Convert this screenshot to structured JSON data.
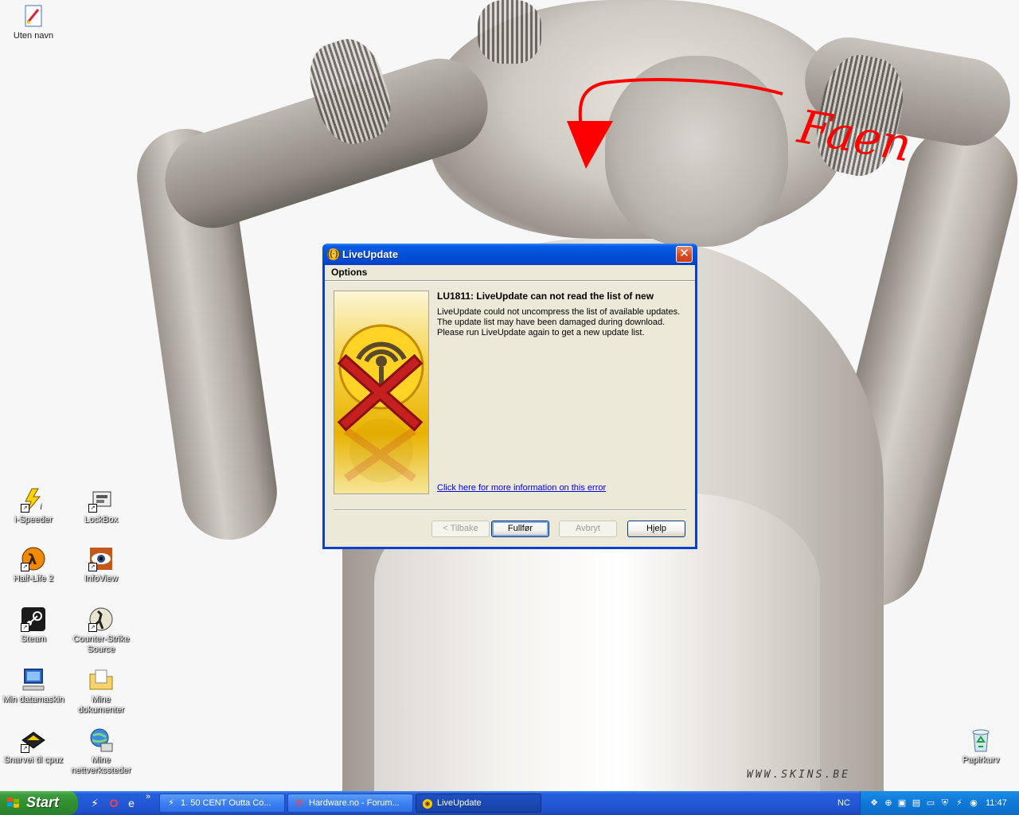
{
  "desktop": {
    "watermark": "WWW.SKINS.BE",
    "scribble_text": "Faen",
    "icons": [
      {
        "label": "Uten navn",
        "icon": "paint-icon"
      },
      {
        "label": "i-Speeder",
        "icon": "lightning-icon"
      },
      {
        "label": "LockBox",
        "icon": "lockbox-icon"
      },
      {
        "label": "Half-Life 2",
        "icon": "half-life-icon"
      },
      {
        "label": "InfoView",
        "icon": "eye-icon"
      },
      {
        "label": "Steam",
        "icon": "steam-icon"
      },
      {
        "label": "Counter-Strike",
        "label2": "Source",
        "icon": "counter-strike-icon"
      },
      {
        "label": "Min datamaskin",
        "icon": "computer-icon"
      },
      {
        "label": "Mine",
        "label2": "dokumenter",
        "icon": "folder-icon"
      },
      {
        "label": "Snarvei til cpuz",
        "icon": "chip-icon"
      },
      {
        "label": "Mine",
        "label2": "nettverkssteder",
        "icon": "network-icon"
      },
      {
        "label": "Papirkurv",
        "icon": "recycle-bin-icon"
      }
    ]
  },
  "dialog": {
    "title": "LiveUpdate",
    "menu": [
      "Options"
    ],
    "headline": "LU1811: LiveUpdate can not read the list of new",
    "body_lines": [
      "LiveUpdate could not uncompress the list of available updates.",
      "The update list may have been damaged during download.",
      "Please run LiveUpdate again to get a new update list."
    ],
    "link": "Click here for more information on this error",
    "buttons": {
      "back": "< Tilbake",
      "finish": "Fullfør",
      "cancel": "Avbryt",
      "help": "Hjelp"
    }
  },
  "taskbar": {
    "start_label": "Start",
    "more": "»",
    "tasks": [
      {
        "label": "1. 50 CENT Outta Co...",
        "icon": "winamp-icon"
      },
      {
        "label": "Hardware.no - Forum...",
        "icon": "opera-icon"
      },
      {
        "label": "LiveUpdate",
        "icon": "liveupdate-icon"
      }
    ],
    "language": "NC",
    "clock": "11:47"
  },
  "colors": {
    "xp_blue": "#0a5ce6",
    "start_green": "#3c9b3c",
    "dialog_face": "#ece9d8",
    "scribble_red": "#ff0000"
  }
}
